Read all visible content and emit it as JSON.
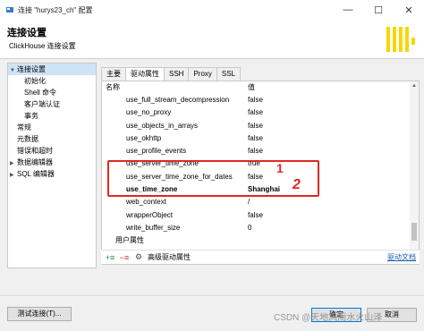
{
  "window": {
    "title": "连接 \"hurys23_ch\" 配置",
    "minimize_glyph": "—",
    "maximize_glyph": "☐",
    "close_glyph": "✕"
  },
  "header": {
    "title": "连接设置",
    "subtitle": "ClickHouse 连接设置",
    "logo_color": "#f5d700"
  },
  "tree": [
    {
      "label": "连接设置",
      "selected": true,
      "expandable": true,
      "indent": 0
    },
    {
      "label": "初始化",
      "indent": 1
    },
    {
      "label": "Shell 命令",
      "indent": 1
    },
    {
      "label": "客户端认证",
      "indent": 1
    },
    {
      "label": "事务",
      "indent": 1
    },
    {
      "label": "常规",
      "indent": 0
    },
    {
      "label": "元数据",
      "indent": 0
    },
    {
      "label": "错误和超时",
      "indent": 0
    },
    {
      "label": "数据编辑器",
      "expandable": true,
      "indent": 0
    },
    {
      "label": "SQL 编辑器",
      "expandable": true,
      "indent": 0
    }
  ],
  "tabs": [
    {
      "label": "主要"
    },
    {
      "label": "驱动属性",
      "active": true
    },
    {
      "label": "SSH"
    },
    {
      "label": "Proxy"
    },
    {
      "label": "SSL"
    }
  ],
  "grid": {
    "col_name": "名称",
    "col_value": "值",
    "rows": [
      {
        "key": "use_full_stream_decompression",
        "value": "false"
      },
      {
        "key": "use_no_proxy",
        "value": "false"
      },
      {
        "key": "use_objects_in_arrays",
        "value": "false"
      },
      {
        "key": "use_okhttp",
        "value": "false"
      },
      {
        "key": "use_profile_events",
        "value": "false"
      },
      {
        "key": "use_server_time_zone",
        "value": "true"
      },
      {
        "key": "use_server_time_zone_for_dates",
        "value": "false"
      },
      {
        "key": "use_time_zone",
        "value": "Shanghai",
        "bold": true
      },
      {
        "key": "web_context",
        "value": "/"
      },
      {
        "key": "wrapperObject",
        "value": "false"
      },
      {
        "key": "write_buffer_size",
        "value": "0"
      },
      {
        "key": "用户属性",
        "value": "",
        "group": true
      }
    ]
  },
  "annotations": {
    "mark1": "1",
    "mark2": "2",
    "color": "#e0281e"
  },
  "toolbar": {
    "advanced_label": "高级驱动属性",
    "driver_docs_link": "驱动文档"
  },
  "footer": {
    "test_button": "测试连接(T)...",
    "ok_button": "确定",
    "cancel_button": "取消",
    "watermark": "CSDN @天地风雨水火山泽"
  },
  "colors": {
    "accent": "#0078d7",
    "selection": "#cfe3f7",
    "link": "#1a5fb4"
  }
}
